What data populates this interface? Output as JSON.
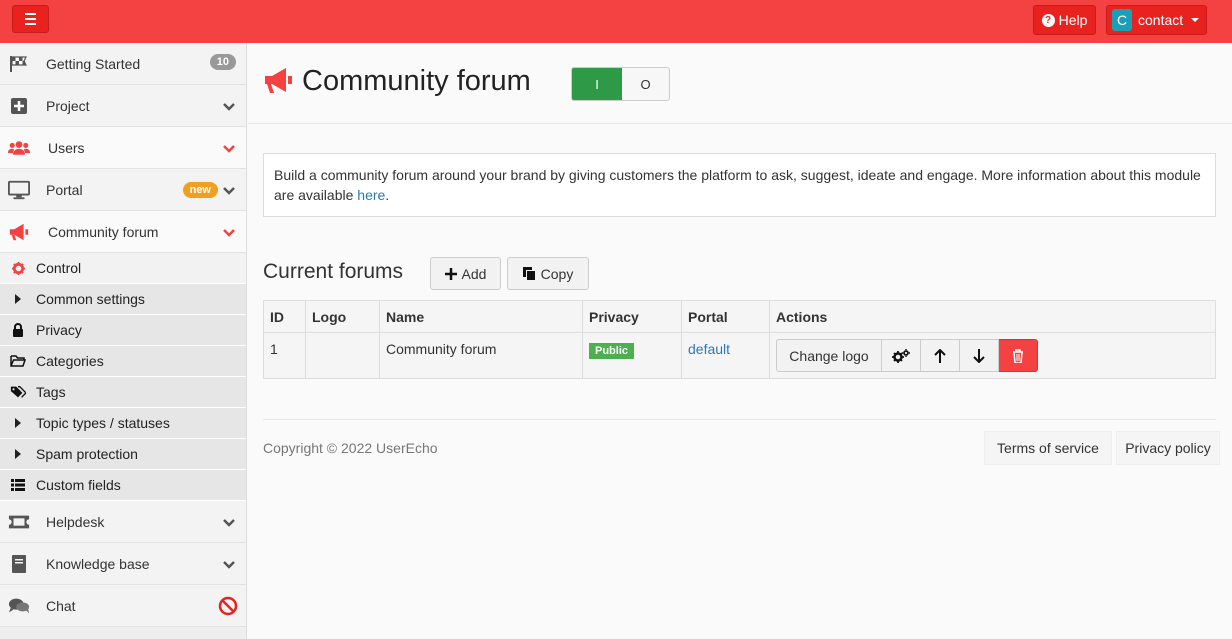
{
  "topbar": {
    "help_label": "Help",
    "user_initial": "C",
    "user_label": "contact"
  },
  "sidebar": {
    "items": [
      {
        "label": "Getting Started",
        "badge": "10"
      },
      {
        "label": "Project"
      },
      {
        "label": "Users"
      },
      {
        "label": "Portal",
        "badge": "new"
      },
      {
        "label": "Community forum"
      }
    ],
    "subitems": [
      "Control",
      "Common settings",
      "Privacy",
      "Categories",
      "Tags",
      "Topic types / statuses",
      "Spam protection",
      "Custom fields"
    ],
    "bottom_items": [
      {
        "label": "Helpdesk"
      },
      {
        "label": "Knowledge base"
      },
      {
        "label": "Chat"
      }
    ]
  },
  "main": {
    "title": "Community forum",
    "toggle": {
      "on": "I",
      "off": "O"
    },
    "info_text": "Build a community forum around your brand by giving customers the platform to ask, suggest, ideate and engage. More information about this module are available ",
    "info_link": "here",
    "info_end": ".",
    "section_title": "Current forums",
    "add_label": "Add",
    "copy_label": "Copy",
    "table": {
      "headers": [
        "ID",
        "Logo",
        "Name",
        "Privacy",
        "Portal",
        "Actions"
      ],
      "rows": [
        {
          "id": "1",
          "logo": "",
          "name": "Community forum",
          "privacy": "Public",
          "portal": "default",
          "action_label": "Change logo"
        }
      ]
    }
  },
  "footer": {
    "copyright": "Copyright © 2022 UserEcho",
    "links": [
      "Terms of service",
      "Privacy policy"
    ]
  },
  "colors": {
    "brand": "#f44242",
    "toggle_on": "#2e9a47",
    "public_badge": "#4caf50",
    "new_badge": "#f0a020",
    "link": "#2a7ab8"
  }
}
